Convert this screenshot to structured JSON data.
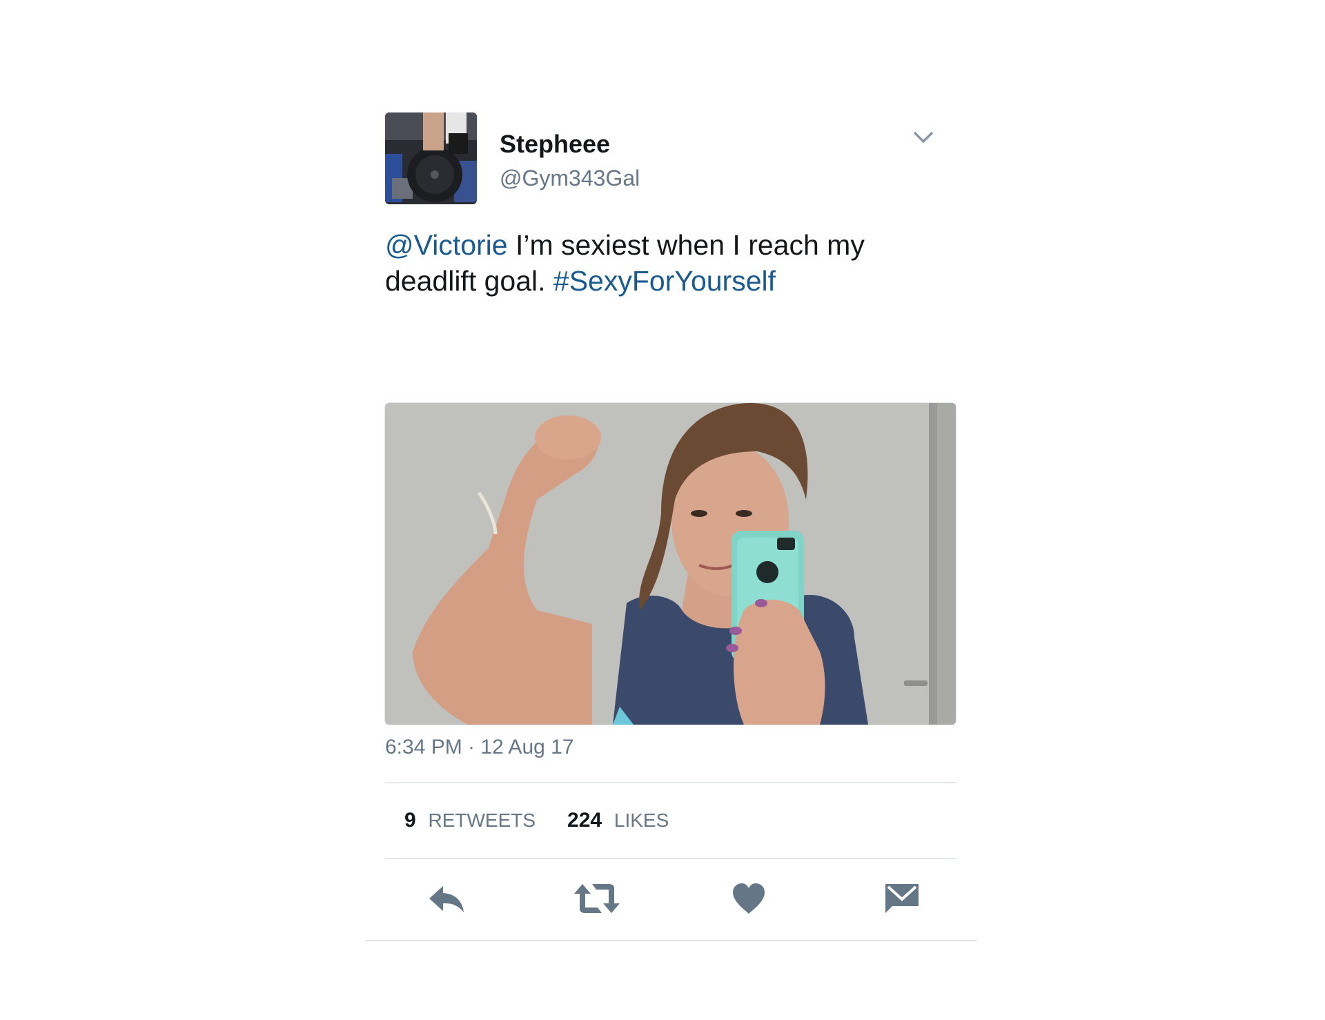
{
  "user": {
    "display_name": "Stepheee",
    "handle": "@Gym343Gal"
  },
  "tweet": {
    "mention": "@Victorie",
    "text_part1": " I’m sexiest when I reach my deadlift goal. ",
    "hashtag": "#SexyForYourself",
    "timestamp": "6:34 PM · 12 Aug 17"
  },
  "stats": {
    "retweets_count": "9",
    "retweets_label": "RETWEETS",
    "likes_count": "224",
    "likes_label": "LIKES"
  },
  "icons": {
    "menu": "chevron-down-icon",
    "reply": "reply-icon",
    "retweet": "retweet-icon",
    "like": "heart-icon",
    "message": "envelope-icon"
  },
  "colors": {
    "link": "#1b5a8f",
    "icon": "#657786",
    "text": "#14171a",
    "divider": "#e1e8ed"
  }
}
